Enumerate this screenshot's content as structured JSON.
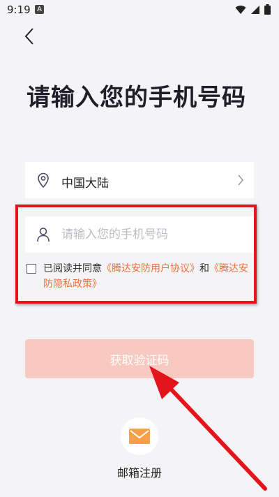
{
  "status_bar": {
    "time": "9:19",
    "notification_badge": "A",
    "icons": [
      "wifi-icon",
      "signal-icon",
      "battery-icon"
    ]
  },
  "header": {
    "back_icon": "chevron-left-icon",
    "title": "请输入您的手机号码"
  },
  "region": {
    "icon": "location-pin-icon",
    "label": "中国大陆",
    "chevron_icon": "chevron-right-icon"
  },
  "phone": {
    "icon": "user-icon",
    "value": "",
    "placeholder": "请输入您的手机号码"
  },
  "agreement": {
    "checked": false,
    "prefix": "已阅读并同意",
    "user_agreement": "《腾达安防用户协议》",
    "conjunction": "和",
    "privacy_policy": "《腾达安防隐私政策》"
  },
  "primary_button": {
    "label": "获取验证码"
  },
  "email_register": {
    "icon": "envelope-icon",
    "label": "邮箱注册"
  },
  "colors": {
    "background": "#f4f4f6",
    "accent_link": "#f07038",
    "button_disabled": "#f7c9c0",
    "annotation_red": "#e3141c",
    "envelope_orange": "#f5a04a"
  }
}
